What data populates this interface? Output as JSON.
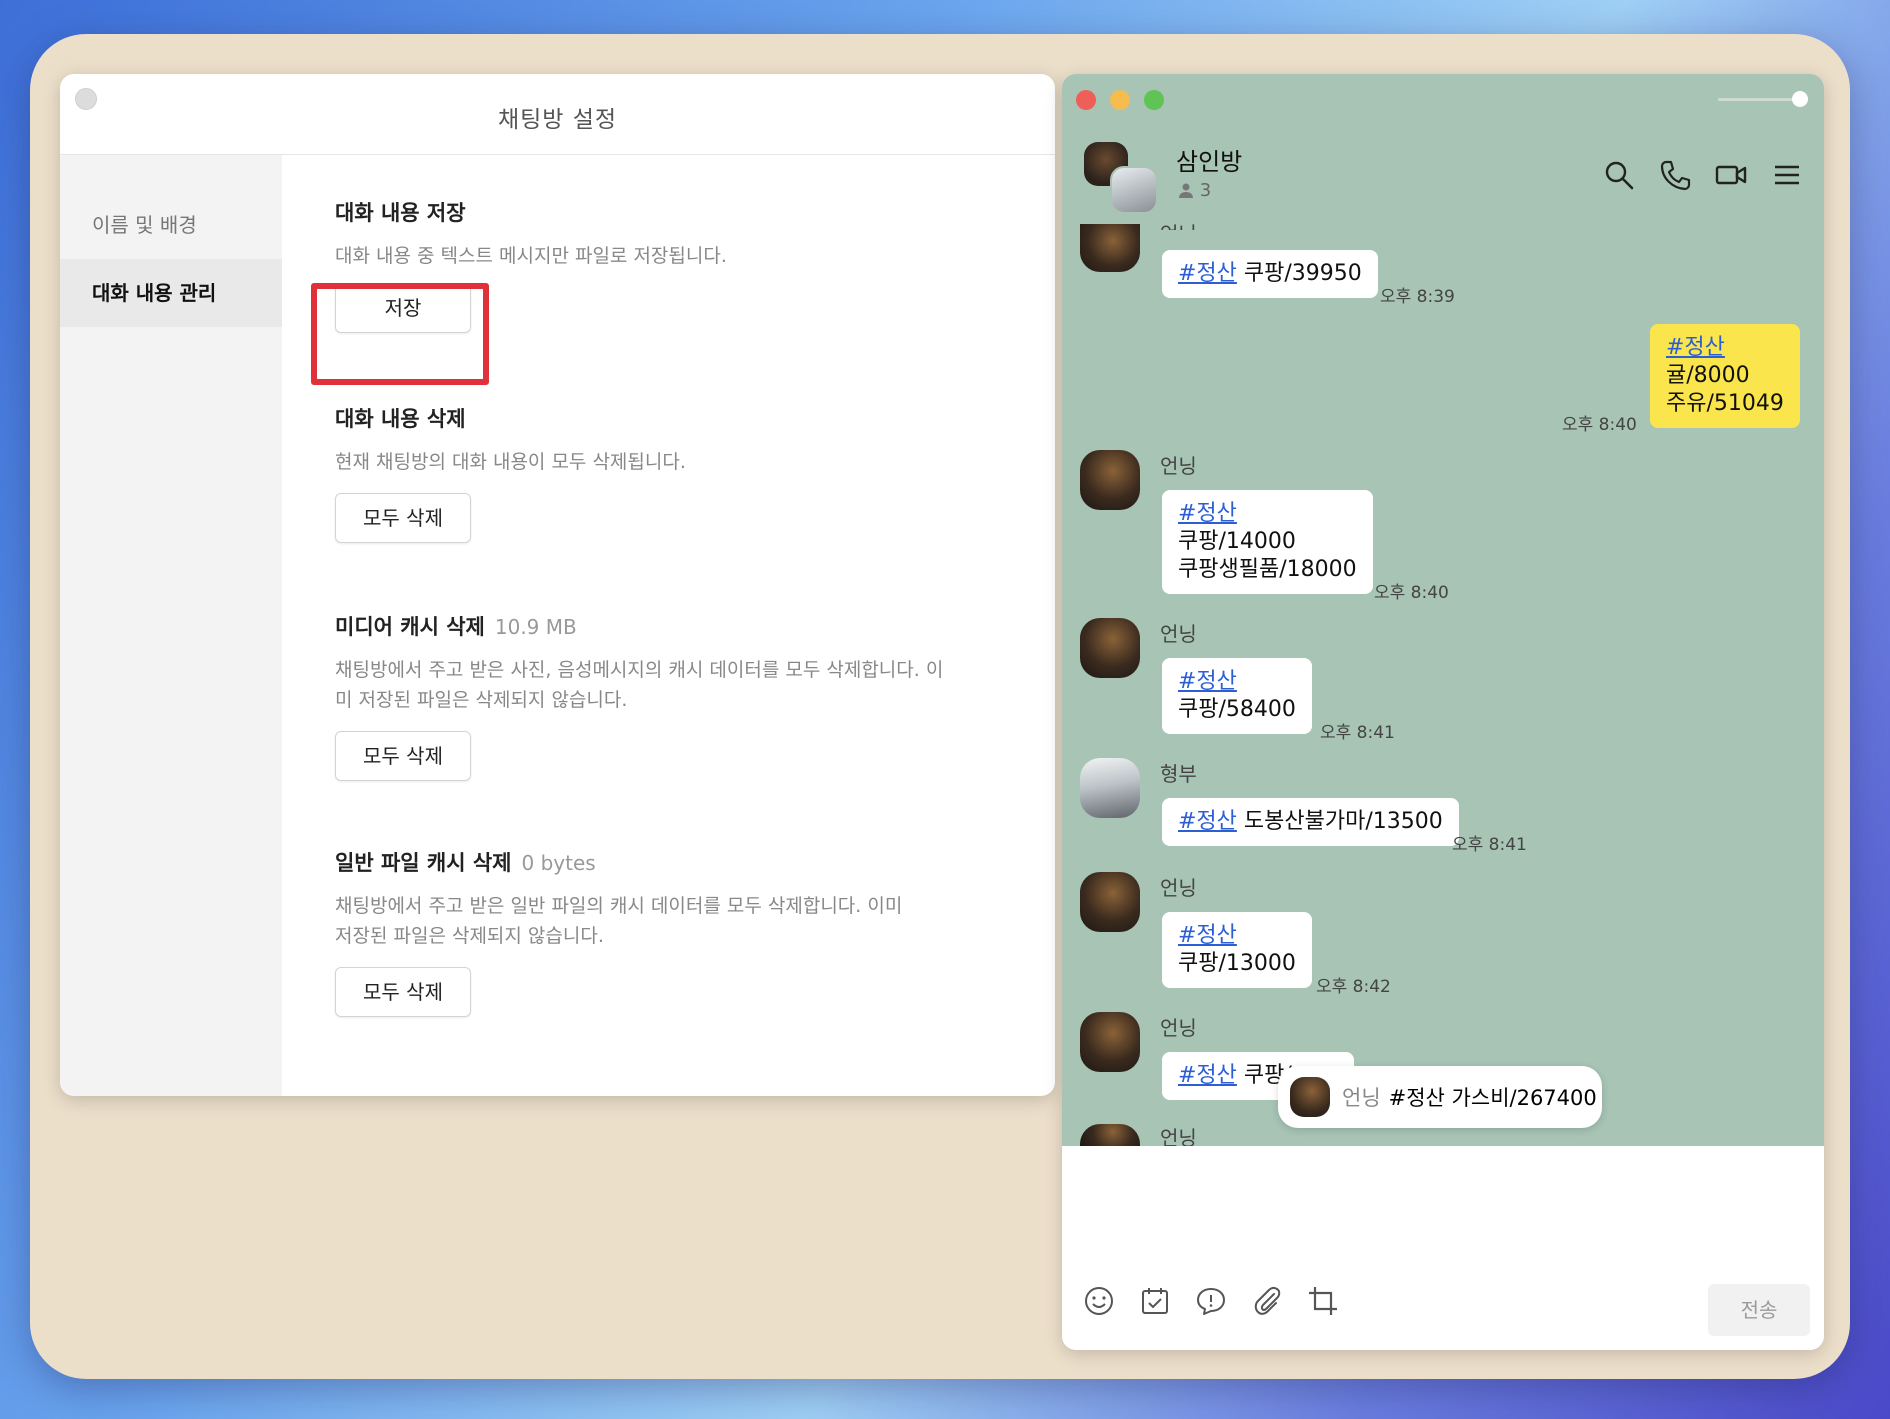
{
  "settings": {
    "title": "채팅방 설정",
    "sidebar": [
      {
        "label": "이름 및 배경",
        "active": false
      },
      {
        "label": "대화 내용 관리",
        "active": true
      }
    ],
    "sections": [
      {
        "title": "대화 내용 저장",
        "size": "",
        "desc": "대화 내용 중 텍스트 메시지만 파일로 저장됩니다.",
        "button": "저장"
      },
      {
        "title": "대화 내용 삭제",
        "size": "",
        "desc": "현재 채팅방의 대화 내용이 모두 삭제됩니다.",
        "button": "모두 삭제"
      },
      {
        "title": "미디어 캐시 삭제",
        "size": "10.9 MB",
        "desc_lines": [
          "채팅방에서 주고 받은 사진, 음성메시지의 캐시 데이터를 모두 삭제합니다. 이",
          "미 저장된 파일은 삭제되지 않습니다."
        ],
        "button": "모두 삭제"
      },
      {
        "title": "일반 파일 캐시 삭제",
        "size": "0 bytes",
        "desc_lines": [
          "채팅방에서 주고 받은 일반 파일의 캐시 데이터를 모두 삭제합니다. 이미",
          "저장된 파일은 삭제되지 않습니다."
        ],
        "button": "모두 삭제"
      }
    ]
  },
  "chat": {
    "room_name": "삼인방",
    "member_count": "3",
    "header_icons": [
      "search-icon",
      "phone-icon",
      "video-icon",
      "menu-icon"
    ],
    "messages": [
      {
        "sender": "",
        "partial_sender": "언닝",
        "lines": [
          {
            "tag": "#정산",
            "text": " 쿠팡/39950"
          }
        ],
        "time": "오후 8:39"
      },
      {
        "sender": "me",
        "lines": [
          {
            "tag": "#정산",
            "text": ""
          },
          {
            "tag": "",
            "text": "귤/8000"
          },
          {
            "tag": "",
            "text": "주유/51049"
          }
        ],
        "time": "오후 8:40"
      },
      {
        "sender": "언닝",
        "lines": [
          {
            "tag": "#정산",
            "text": ""
          },
          {
            "tag": "",
            "text": "쿠팡/14000"
          },
          {
            "tag": "",
            "text": "쿠팡생필품/18000"
          }
        ],
        "time": "오후 8:40"
      },
      {
        "sender": "언닝",
        "lines": [
          {
            "tag": "#정산",
            "text": ""
          },
          {
            "tag": "",
            "text": "쿠팡/58400"
          }
        ],
        "time": "오후 8:41"
      },
      {
        "sender": "형부",
        "lines": [
          {
            "tag": "#정산",
            "text": " 도봉산불가마/13500"
          }
        ],
        "time": "오후 8:41"
      },
      {
        "sender": "언닝",
        "lines": [
          {
            "tag": "#정산",
            "text": ""
          },
          {
            "tag": "",
            "text": "쿠팡/13000"
          }
        ],
        "time": "오후 8:42"
      },
      {
        "sender": "언닝",
        "lines": [
          {
            "tag": "#정산",
            "text": " 쿠팡/"
          }
        ],
        "time": ""
      },
      {
        "sender": "언닝",
        "lines": [],
        "time": ""
      }
    ],
    "popup": {
      "sender": "언닝",
      "text": "#정산 가스비/267400"
    },
    "toolbar_icons": [
      "emoji-icon",
      "calendar-check-icon",
      "speech-bubble-icon",
      "paperclip-icon",
      "crop-icon"
    ],
    "send_label": "전송"
  },
  "colors": {
    "chat_background": "#a7c4b5",
    "my_bubble": "#fae64c",
    "hashtag": "#2c5fd3",
    "highlight_box": "#e0303a"
  }
}
